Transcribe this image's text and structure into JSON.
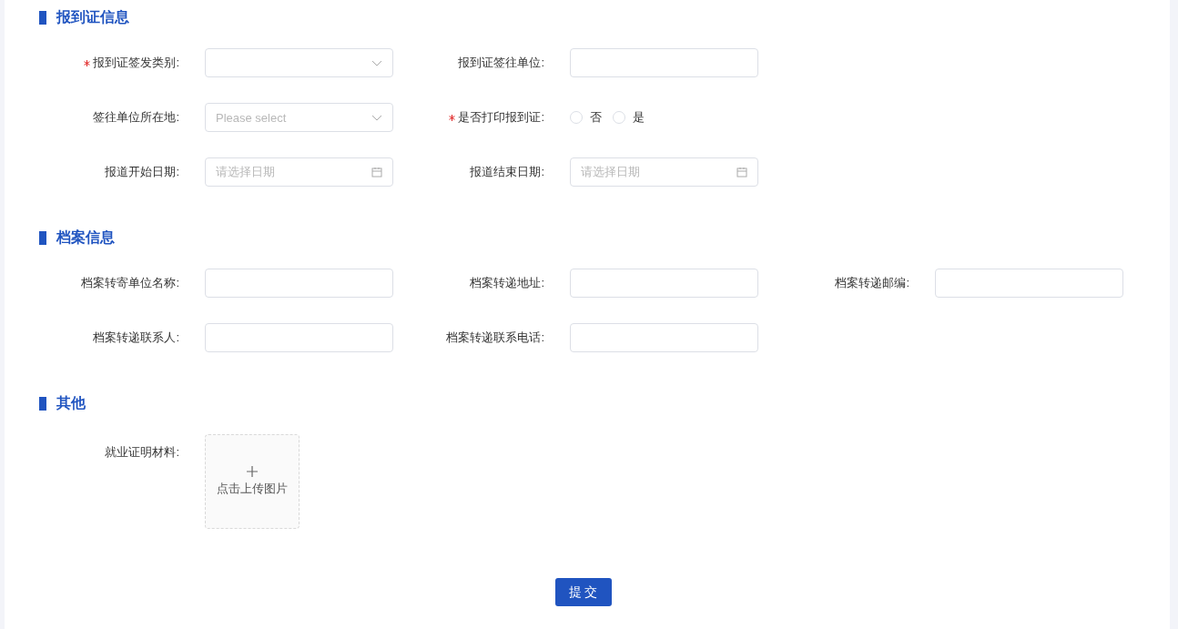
{
  "sections": [
    {
      "title": "报到证信息",
      "rows": [
        [
          {
            "label": "报到证签发类别:",
            "required": true,
            "kind": "select"
          },
          {
            "label": "报到证签往单位:",
            "required": false,
            "kind": "long-input"
          }
        ],
        [
          {
            "label": "签往单位所在地:",
            "required": false,
            "kind": "select",
            "placeholder": "Please select"
          },
          {
            "label": "是否打印报到证:",
            "required": true,
            "kind": "radio",
            "options": [
              {
                "label": "否",
                "selected": false
              },
              {
                "label": "是",
                "selected": false
              }
            ]
          }
        ],
        [
          {
            "label": "报道开始日期:",
            "required": false,
            "kind": "date",
            "placeholder": "请选择日期"
          },
          {
            "label": "报道结束日期:",
            "required": false,
            "kind": "date",
            "placeholder": "请选择日期"
          }
        ]
      ]
    },
    {
      "title": "档案信息",
      "rows": [
        [
          {
            "label": "档案转寄单位名称:",
            "required": false,
            "kind": "input"
          },
          {
            "label": "档案转递地址:",
            "required": false,
            "kind": "input"
          },
          {
            "label": "档案转递邮编:",
            "required": false,
            "kind": "input"
          }
        ],
        [
          {
            "label": "档案转递联系人:",
            "required": false,
            "kind": "input"
          },
          {
            "label": "档案转递联系电话:",
            "required": false,
            "kind": "input"
          }
        ]
      ]
    },
    {
      "title": "其他",
      "rows": [
        [
          {
            "label": "就业证明材料:",
            "required": false,
            "kind": "upload",
            "text": "点击上传图片"
          }
        ]
      ]
    }
  ],
  "submit": "提 交"
}
